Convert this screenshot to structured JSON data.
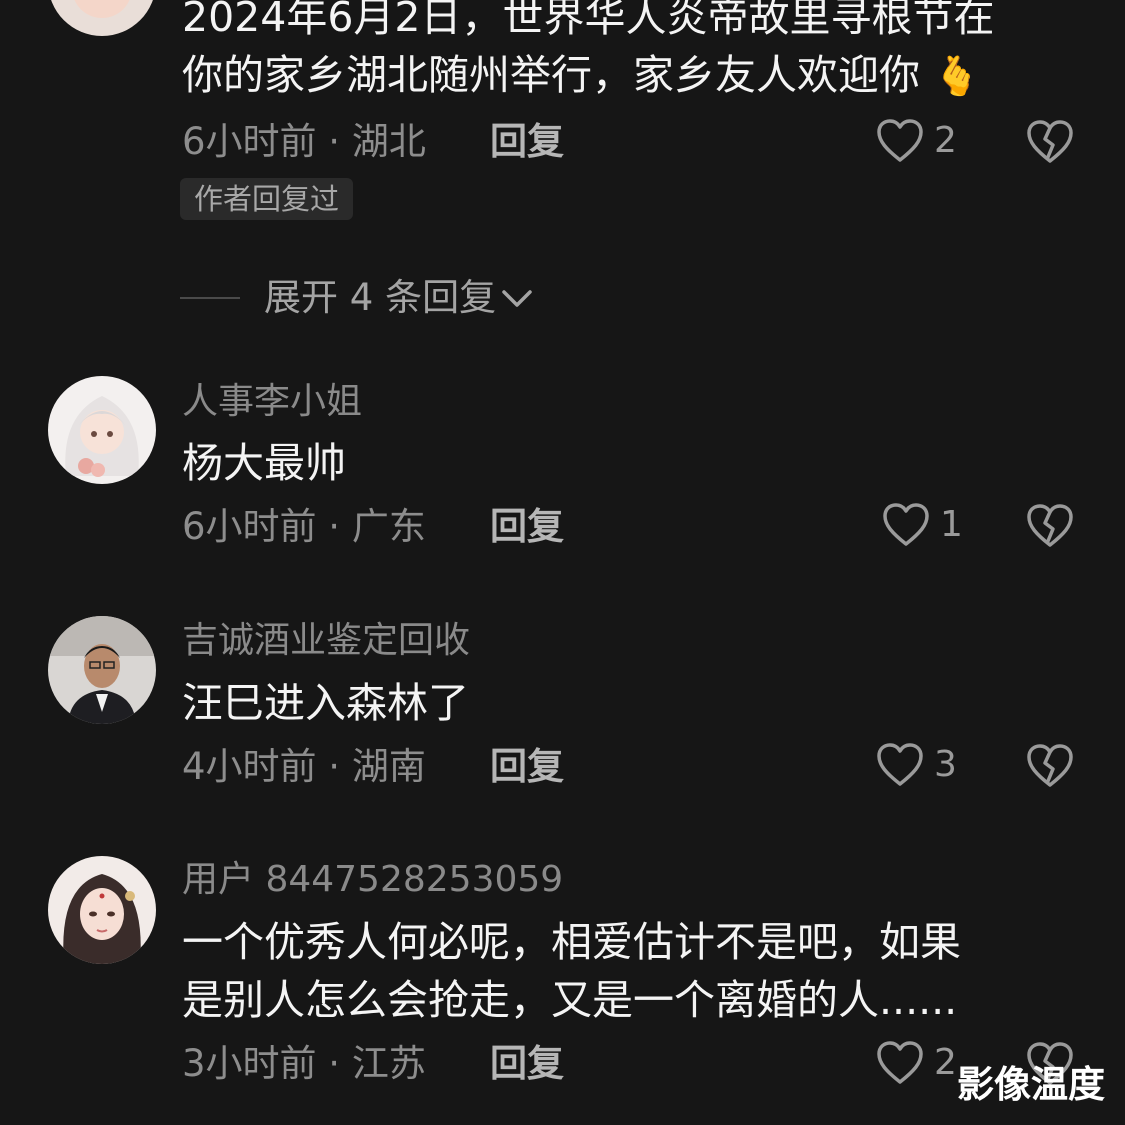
{
  "comments": [
    {
      "text_lines": [
        "2024年6月2日，世界华人炎帝故里寻根节在",
        "你的家乡湖北随州举行，家乡友人欢迎你"
      ],
      "emoji": "🫰",
      "meta": "6小时前 · 湖北",
      "reply_label": "回复",
      "likes": "2",
      "author_tag": "作者回复过",
      "expand_label": "展开 4 条回复"
    },
    {
      "username": "人事李小姐",
      "text": "杨大最帅",
      "meta": "6小时前 · 广东",
      "reply_label": "回复",
      "likes": "1"
    },
    {
      "username": "吉诚酒业鉴定回收",
      "text": "汪巳进入森林了",
      "meta": "4小时前 · 湖南",
      "reply_label": "回复",
      "likes": "3"
    },
    {
      "username": "用户 8447528253059",
      "text_lines": [
        "一个优秀人何必呢，相爱估计不是吧，如果",
        "是别人怎么会抢走，又是一个离婚的人......"
      ],
      "meta": "3小时前 · 江苏",
      "reply_label": "回复",
      "likes": "2"
    }
  ],
  "watermark": "影像温度",
  "icons": {
    "like": "heart-outline-icon",
    "dislike": "broken-heart-icon",
    "expand": "chevron-down-icon"
  },
  "colors": {
    "background": "#161616",
    "primary_text": "#f4f4f4",
    "secondary_text": "#8a8a8a"
  }
}
